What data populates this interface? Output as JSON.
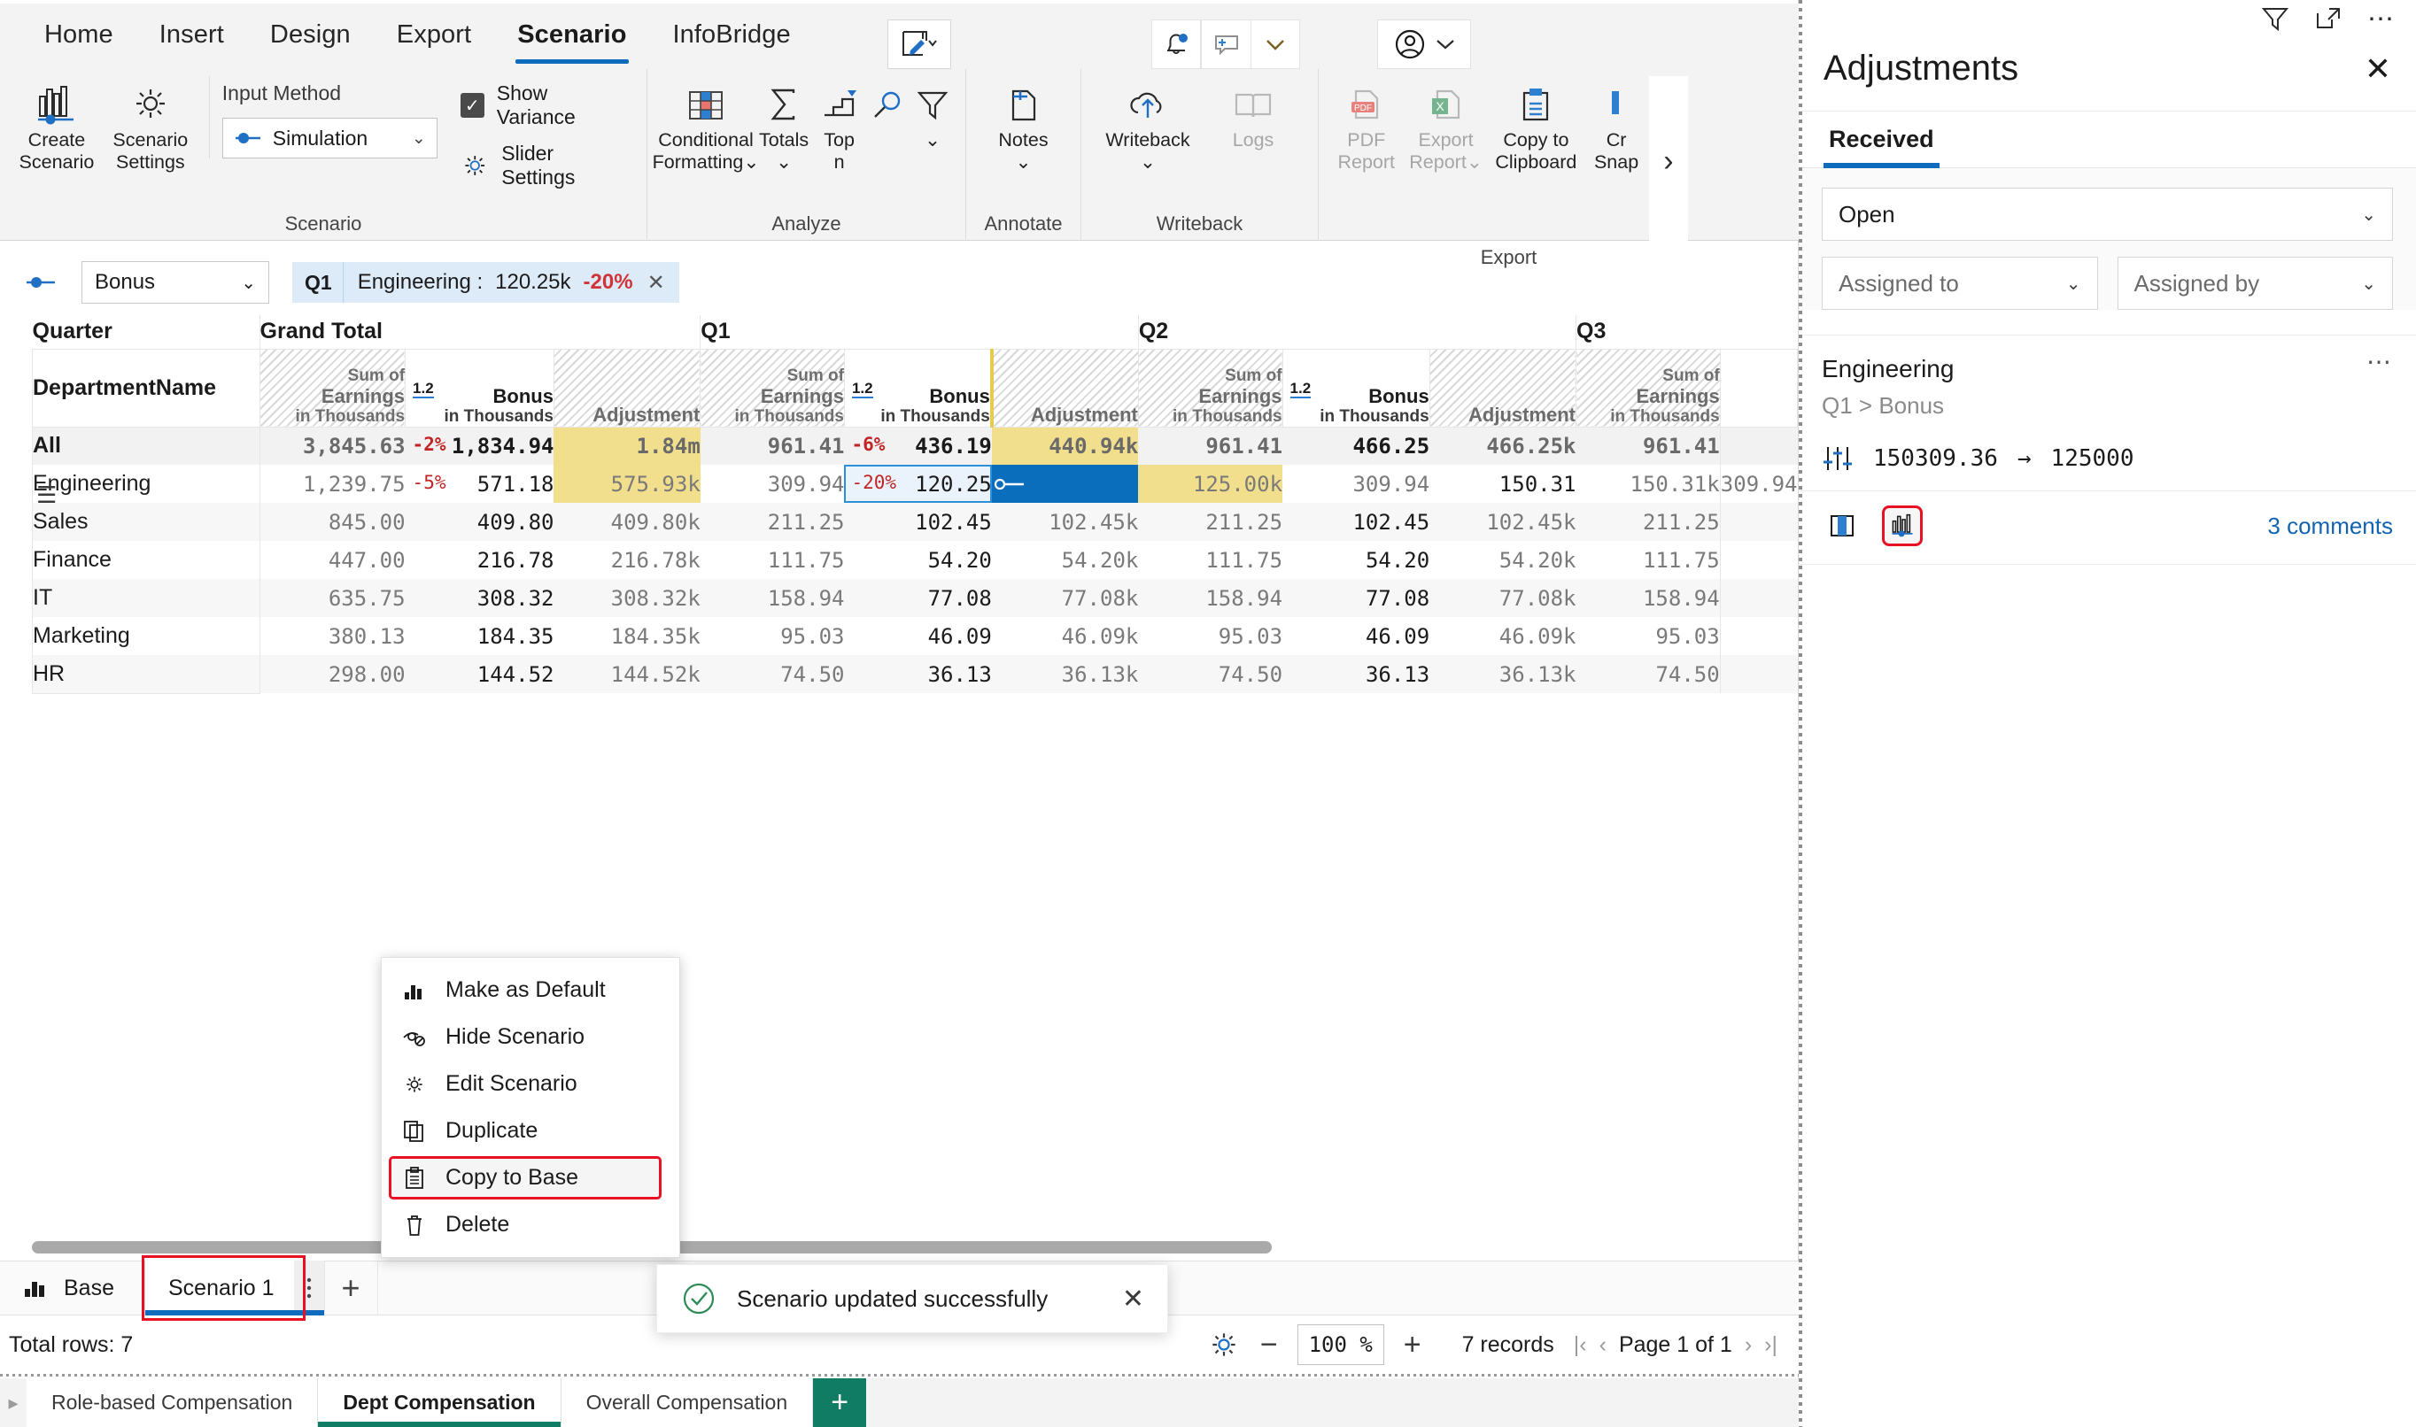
{
  "ribbon": {
    "tabs": [
      {
        "label": "Home",
        "active": false
      },
      {
        "label": "Insert",
        "active": false
      },
      {
        "label": "Design",
        "active": false
      },
      {
        "label": "Export",
        "active": false
      },
      {
        "label": "Scenario",
        "active": true
      },
      {
        "label": "InfoBridge",
        "active": false
      }
    ],
    "groups": {
      "scenario": {
        "label": "Scenario",
        "create_scenario": "Create\nScenario",
        "create_scenario_l1": "Create",
        "create_scenario_l2": "Scenario",
        "scenario_settings_l1": "Scenario",
        "scenario_settings_l2": "Settings",
        "input_method_label": "Input Method",
        "input_method_value": "Simulation",
        "show_variance": "Show Variance",
        "show_variance_checked": true,
        "slider_settings": "Slider Settings"
      },
      "analyze": {
        "label": "Analyze",
        "conditional_formatting_l1": "Conditional",
        "conditional_formatting_l2": "Formatting",
        "totals": "Totals",
        "top_n": "Top n"
      },
      "annotate": {
        "label": "Annotate",
        "notes": "Notes"
      },
      "writeback": {
        "label": "Writeback",
        "writeback": "Writeback",
        "logs": "Logs"
      },
      "export": {
        "label": "Export",
        "pdf_report_l1": "PDF",
        "pdf_report_l2": "Report",
        "export_report_l1": "Export",
        "export_report_l2": "Report",
        "copy_clipboard_l1": "Copy to",
        "copy_clipboard_l2": "Clipboard",
        "create_snapshot_l1": "Cr",
        "create_snapshot_l2": "Snap"
      }
    }
  },
  "slicer": {
    "measure": "Bonus",
    "chip": {
      "quarter": "Q1",
      "dimension": "Engineering :",
      "value": "120.25k",
      "variance": "-20%"
    }
  },
  "table": {
    "corner_top": "Quarter",
    "corner_bottom": "DepartmentName",
    "column_groups": [
      {
        "label": "Grand Total",
        "span": 3
      },
      {
        "label": "Q1",
        "span": 3
      },
      {
        "label": "Q2",
        "span": 3
      },
      {
        "label": "Q3",
        "span": 1
      }
    ],
    "columns": [
      {
        "l1": "Sum of",
        "l2": "Earnings",
        "l3": "in Thousands",
        "kind": "hatch"
      },
      {
        "l1": "",
        "l2": "Bonus",
        "l3": "in Thousands",
        "kind": "bonus",
        "sup": "1.2"
      },
      {
        "l1": "",
        "l2": "Adjustment",
        "l3": "",
        "kind": "hatch"
      },
      {
        "l1": "Sum of",
        "l2": "Earnings",
        "l3": "in Thousands",
        "kind": "hatch"
      },
      {
        "l1": "",
        "l2": "Bonus",
        "l3": "in Thousands",
        "kind": "bonus",
        "sup": "1.2"
      },
      {
        "l1": "",
        "l2": "Adjustment",
        "l3": "",
        "kind": "hatch"
      },
      {
        "l1": "Sum of",
        "l2": "Earnings",
        "l3": "in Thousands",
        "kind": "hatch"
      },
      {
        "l1": "",
        "l2": "Bonus",
        "l3": "in Thousands",
        "kind": "bonus",
        "sup": "1.2"
      },
      {
        "l1": "",
        "l2": "Adjustment",
        "l3": "",
        "kind": "hatch"
      },
      {
        "l1": "Sum of",
        "l2": "Earnings",
        "l3": "in Thousands",
        "kind": "hatch"
      }
    ],
    "rows": [
      {
        "name": "All",
        "total": true,
        "cells": [
          "3,845.63",
          "1,834.94",
          "1.84m",
          "961.41",
          "436.19",
          "440.94k",
          "961.41",
          "466.25",
          "466.25k",
          "961.41"
        ],
        "variance": {
          "1": "-2%",
          "4": "-6%"
        }
      },
      {
        "name": "Engineering",
        "total": false,
        "cells": [
          "1,239.75",
          "571.18",
          "575.93k",
          "309.94",
          "120.25",
          "125.00k",
          "309.94",
          "150.31",
          "150.31k",
          "309.94"
        ],
        "variance": {
          "1": "-5%",
          "4": "-20%"
        }
      },
      {
        "name": "Sales",
        "total": false,
        "cells": [
          "845.00",
          "409.80",
          "409.80k",
          "211.25",
          "102.45",
          "102.45k",
          "211.25",
          "102.45",
          "102.45k",
          "211.25"
        ],
        "variance": {}
      },
      {
        "name": "Finance",
        "total": false,
        "cells": [
          "447.00",
          "216.78",
          "216.78k",
          "111.75",
          "54.20",
          "54.20k",
          "111.75",
          "54.20",
          "54.20k",
          "111.75"
        ],
        "variance": {}
      },
      {
        "name": "IT",
        "total": false,
        "cells": [
          "635.75",
          "308.32",
          "308.32k",
          "158.94",
          "77.08",
          "77.08k",
          "158.94",
          "77.08",
          "77.08k",
          "158.94"
        ],
        "variance": {}
      },
      {
        "name": "Marketing",
        "total": false,
        "cells": [
          "380.13",
          "184.35",
          "184.35k",
          "95.03",
          "46.09",
          "46.09k",
          "95.03",
          "46.09",
          "46.09k",
          "95.03"
        ],
        "variance": {}
      },
      {
        "name": "HR",
        "total": false,
        "cells": [
          "298.00",
          "144.52",
          "144.52k",
          "74.50",
          "36.13",
          "36.13k",
          "74.50",
          "36.13",
          "36.13k",
          "74.50"
        ],
        "variance": {}
      }
    ]
  },
  "context_menu": {
    "items": [
      {
        "label": "Make as Default",
        "icon": "bar-chart-icon",
        "highlight": false
      },
      {
        "label": "Hide Scenario",
        "icon": "eye-off-icon",
        "highlight": false
      },
      {
        "label": "Edit Scenario",
        "icon": "gear-icon",
        "highlight": false
      },
      {
        "label": "Duplicate",
        "icon": "copy-icon",
        "highlight": false
      },
      {
        "label": "Copy to Base",
        "icon": "clipboard-icon",
        "highlight": true
      },
      {
        "label": "Delete",
        "icon": "trash-icon",
        "highlight": false
      }
    ]
  },
  "scenario_bar": {
    "base_label": "Base",
    "scenario_tab": "Scenario 1",
    "add_label": "+"
  },
  "toast": {
    "message": "Scenario updated successfully"
  },
  "status": {
    "total_rows": "Total rows: 7",
    "zoom": "100 %",
    "zoom_out": "−",
    "zoom_in": "+",
    "records": "7 records",
    "page": "Page 1 of 1"
  },
  "sheet_tabs": {
    "tabs": [
      {
        "label": "Role-based Compensation",
        "active": false
      },
      {
        "label": "Dept Compensation",
        "active": true
      },
      {
        "label": "Overall Compensation",
        "active": false
      }
    ],
    "add": "+"
  },
  "panel": {
    "title": "Adjustments",
    "tabs": [
      {
        "label": "Received",
        "active": true
      }
    ],
    "filters": {
      "status_value": "Open",
      "assigned_to_placeholder": "Assigned to",
      "assigned_by_placeholder": "Assigned by"
    },
    "cards": [
      {
        "name": "Engineering",
        "path": "Q1 > Bonus",
        "from_value": "150309.36",
        "arrow": "→",
        "to_value": "125000",
        "comments": "3 comments"
      }
    ]
  },
  "colors": {
    "accent_blue": "#0f6cbd",
    "highlight_yellow": "#f2df8d",
    "selection_blue": "#0a6ebd",
    "negative_red": "#c22424",
    "ring_red": "#e81123",
    "sheet_green": "#107c63",
    "link_blue": "#1263b0"
  }
}
